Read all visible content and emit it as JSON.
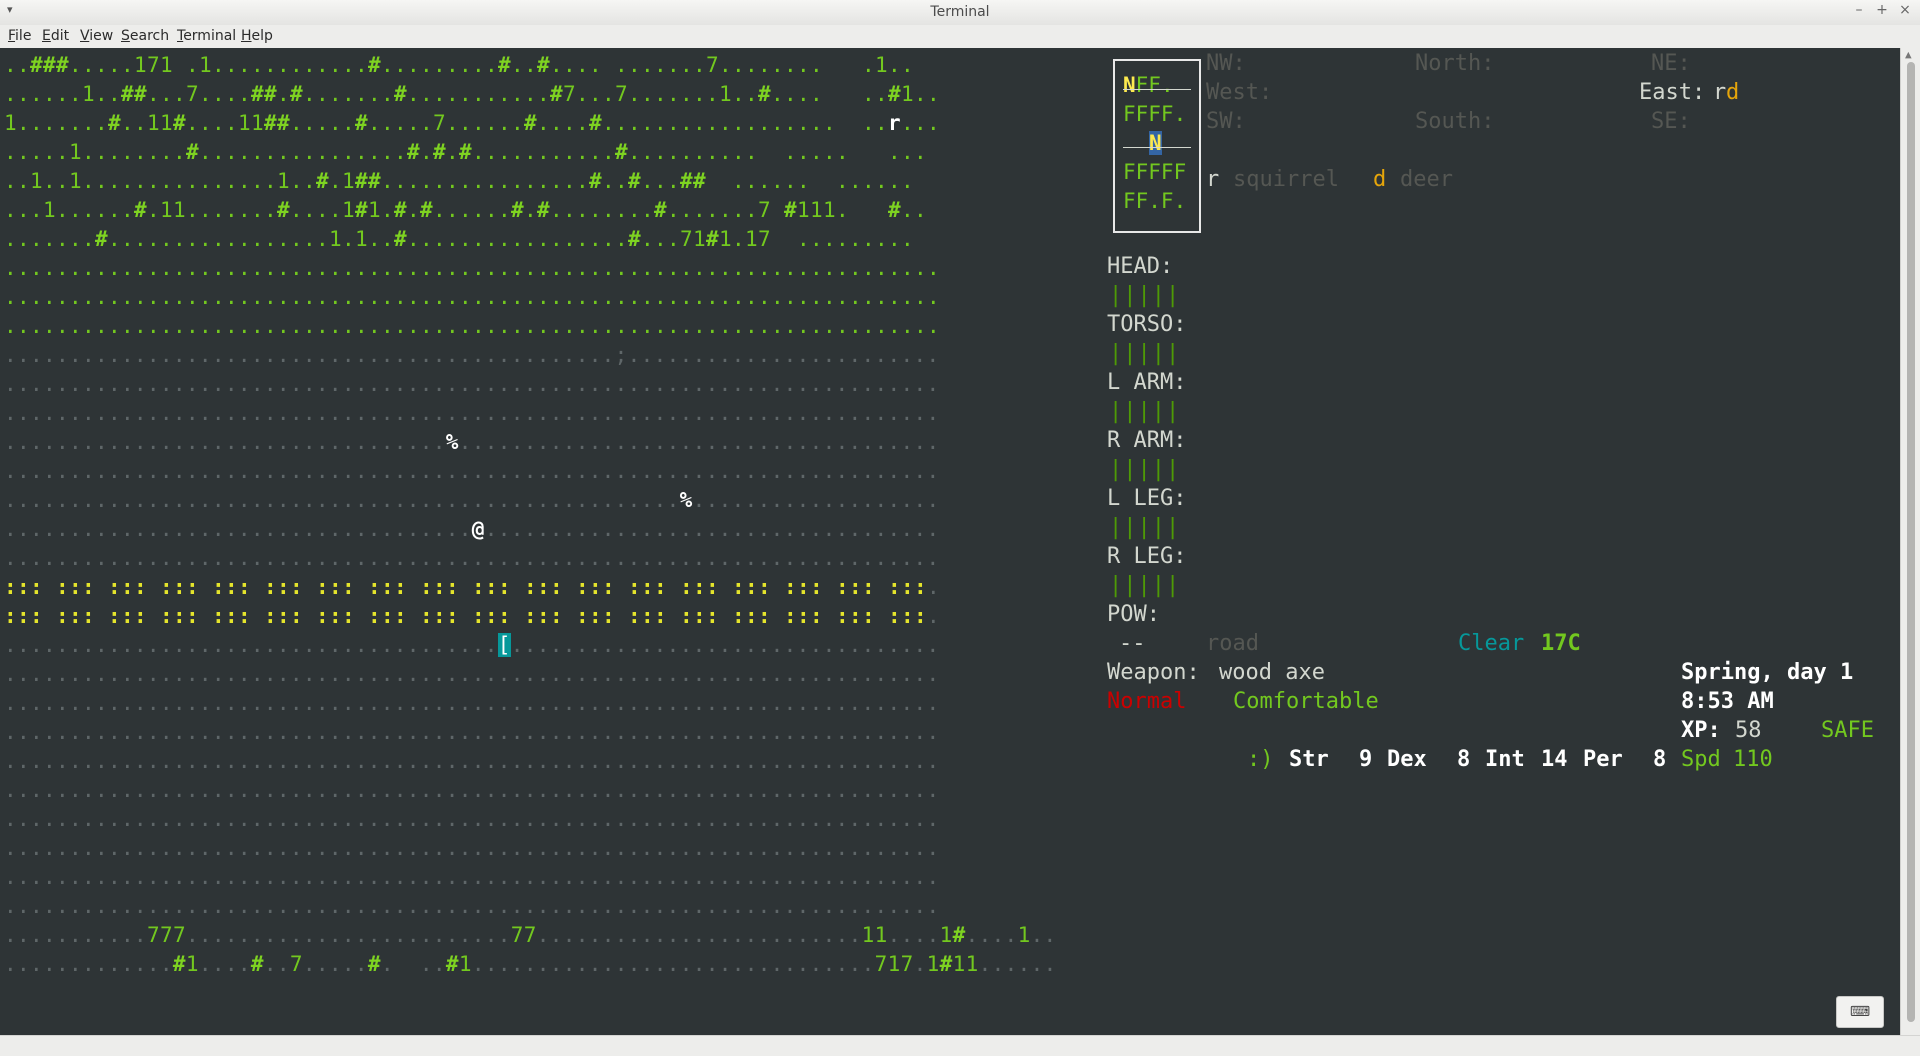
{
  "window": {
    "title": "Terminal",
    "menu_icon": "▾",
    "minimize": "–",
    "maximize": "+",
    "close": "×"
  },
  "menubar": {
    "items": [
      "File",
      "Edit",
      "View",
      "Search",
      "Terminal",
      "Help"
    ]
  },
  "map": {
    "rows": [
      "..###.....171 .1............#.........#..#.... .......7........   .1..",
      "......1..##...7....##.#.......#...........#7...7.......1..#....   ..#1..",
      "1.......#..11#....11##.....#.....7......#....#..................  ..r...",
      ".....1........#................#.#.#...........#..........  .....   ...",
      "..1..1...............1..#.1##................#..#...##  ......  ......",
      "...1......#.11.......#....1#1.#.#......#.#........#.......7 #111.   #..",
      ".......#.................1.1..#.................#...71#1.17  .........",
      "........................................................................",
      "........................................................................",
      "........................................................................",
      "...............................................;........................",
      "........................................................................",
      "........................................................................",
      "..................................%.....................................",
      "........................................................................",
      "....................................................%...................",
      "....................................@...................................",
      "........................................................................",
      "::: ::: ::: ::: ::: ::: ::: ::: ::: ::: ::: ::: ::: ::: ::: ::: ::: :::.",
      "::: ::: ::: ::: ::: ::: ::: ::: ::: ::: ::: ::: ::: ::: ::: ::: ::: :::.",
      "......................................[.................................",
      "........................................................................",
      "........................................................................",
      "........................................................................",
      "........................................................................",
      "........................................................................",
      "........................................................................",
      "........................................................................",
      "........................................................................",
      "........................................................................",
      "...........777.........................77.........................11....1#....1..",
      ".............#1....#..7.....#.  ..#1...............................717.1#11......"
    ]
  },
  "minimap": {
    "row1_center": "N",
    "row1_rest": "FF.",
    "row2": "FFFF.",
    "row3_center": "N",
    "row4": "FFFFF",
    "row5": "FF.F."
  },
  "compass": {
    "nw": "NW:",
    "north": "North:",
    "ne": "NE:",
    "west": "West:",
    "east": "East:",
    "east_r": "r",
    "east_d": "d",
    "sw": "SW:",
    "south": "South:",
    "se": "SE:"
  },
  "legend": {
    "squirrel_sym": "r",
    "squirrel": "squirrel",
    "deer_sym": "d",
    "deer": "deer"
  },
  "body_parts": [
    {
      "label": "HEAD:",
      "bar": "|||||"
    },
    {
      "label": "TORSO:",
      "bar": "|||||"
    },
    {
      "label": "L ARM:",
      "bar": "|||||"
    },
    {
      "label": "R ARM:",
      "bar": "|||||"
    },
    {
      "label": "L LEG:",
      "bar": "|||||"
    },
    {
      "label": "R LEG:",
      "bar": "|||||"
    }
  ],
  "pow": {
    "label": "POW:",
    "value": "--"
  },
  "terrain": "road",
  "weather": {
    "condition": "Clear",
    "temp": "17C"
  },
  "weapon": {
    "label": "Weapon:",
    "value": "wood axe"
  },
  "status": {
    "state": "Normal",
    "comfort": "Comfortable"
  },
  "date": {
    "season_day": "Spring, day 1",
    "time": "8:53 AM"
  },
  "xp": {
    "label": "XP:",
    "value": "58",
    "safety": "SAFE"
  },
  "stats": {
    "mood": ":)",
    "str_label": "Str",
    "str": "9",
    "dex_label": "Dex",
    "dex": "8",
    "int_label": "Int",
    "int": "14",
    "per_label": "Per",
    "per": "8",
    "spd_label": "Spd",
    "spd": "110"
  },
  "keyboard_button": "⌨"
}
